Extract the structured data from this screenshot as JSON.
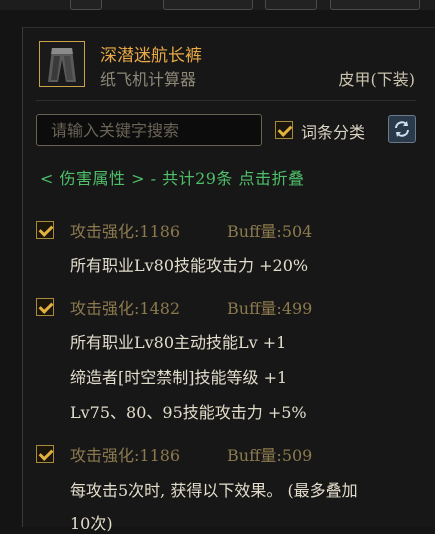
{
  "item": {
    "name": "深潜迷航长裤",
    "source": "纸飞机计算器",
    "type": "皮甲(下装)",
    "icon": "leg-armor-icon"
  },
  "search": {
    "placeholder": "请输入关键字搜索",
    "filter_label": "词条分类",
    "filter_checked": true,
    "refresh_icon": "refresh-icon"
  },
  "section": {
    "header": "< 伤害属性 > - 共计29条 点击折叠"
  },
  "entries": [
    {
      "checked": true,
      "stat": "攻击强化:1186",
      "buff": "Buff量:504",
      "effects": [
        "所有职业Lv80技能攻击力 +20%"
      ]
    },
    {
      "checked": true,
      "stat": "攻击强化:1482",
      "buff": "Buff量:499",
      "effects": [
        "所有职业Lv80主动技能Lv +1",
        "缔造者[时空禁制]技能等级 +1",
        "Lv75、80、95技能攻击力 +5%"
      ]
    },
    {
      "checked": true,
      "stat": "攻击强化:1186",
      "buff": "Buff量:509",
      "effects": [
        "每攻击5次时, 获得以下效果。 (最多叠加",
        "10次)"
      ]
    }
  ],
  "colors": {
    "item_name": "#e8a846",
    "section_header": "#4fc06a",
    "stat_text": "#8c7a4e",
    "checkbox_mark": "#e3b23c"
  }
}
